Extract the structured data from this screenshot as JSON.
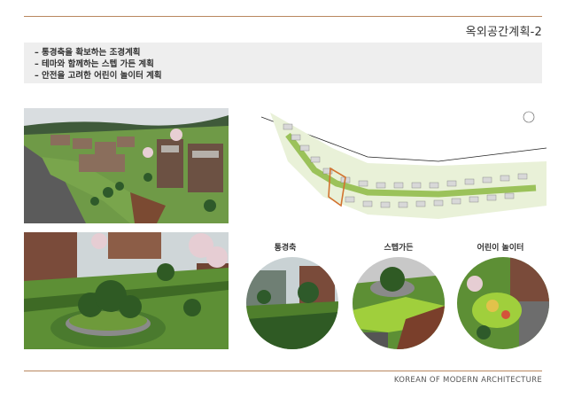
{
  "page": {
    "title": "옥외공간계획-2",
    "summary": [
      "– 통경축을 확보하는 조경계획",
      "– 테마와 함께하는 스텝 가든 계획",
      "– 안전을 고려한 어린이 놀이터 계획"
    ],
    "footer": "KOREAN OF MODERN ARCHITECTURE"
  },
  "circles": [
    {
      "label": "통경축"
    },
    {
      "label": "스텝가든"
    },
    {
      "label": "어린이 놀이터"
    }
  ],
  "colors": {
    "rule": "#b9875f",
    "summary_bg": "#eeeeee",
    "lawn": "#5d8f35",
    "brick": "#7a4b3a",
    "road": "#5a5a5a"
  }
}
